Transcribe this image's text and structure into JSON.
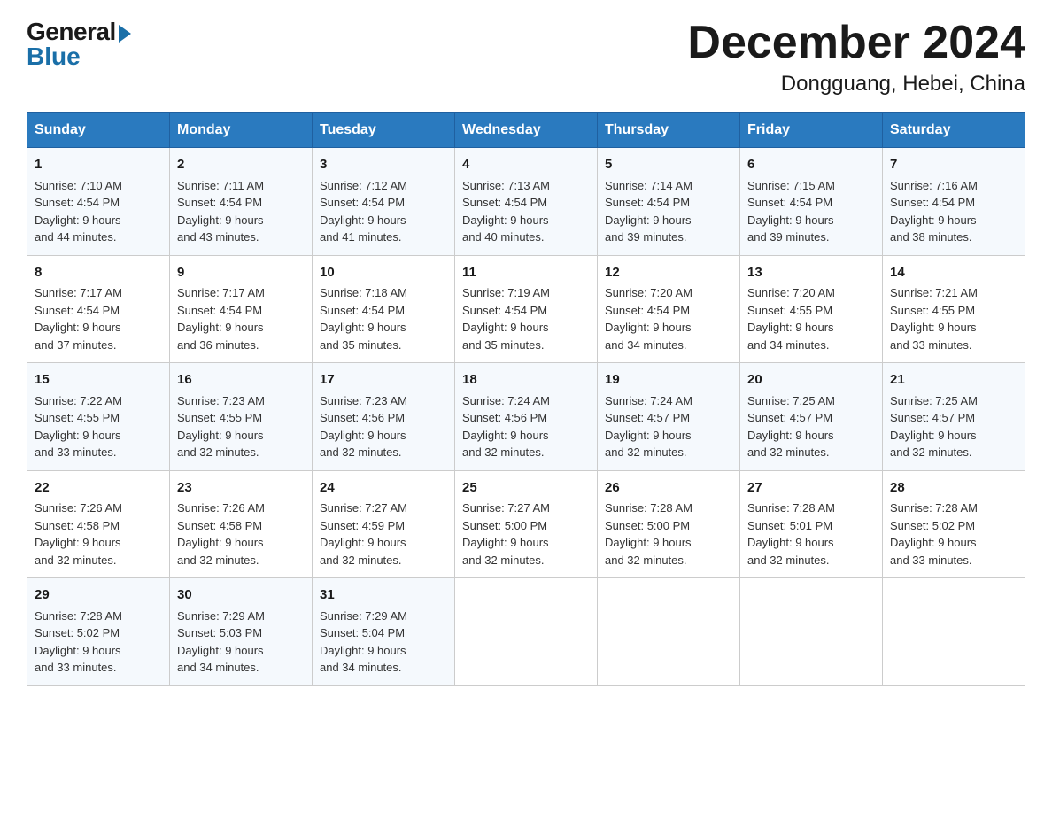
{
  "header": {
    "logo_general": "General",
    "logo_blue": "Blue",
    "month_title": "December 2024",
    "location": "Dongguang, Hebei, China"
  },
  "weekdays": [
    "Sunday",
    "Monday",
    "Tuesday",
    "Wednesday",
    "Thursday",
    "Friday",
    "Saturday"
  ],
  "weeks": [
    [
      {
        "day": "1",
        "sunrise": "7:10 AM",
        "sunset": "4:54 PM",
        "daylight": "9 hours and 44 minutes."
      },
      {
        "day": "2",
        "sunrise": "7:11 AM",
        "sunset": "4:54 PM",
        "daylight": "9 hours and 43 minutes."
      },
      {
        "day": "3",
        "sunrise": "7:12 AM",
        "sunset": "4:54 PM",
        "daylight": "9 hours and 41 minutes."
      },
      {
        "day": "4",
        "sunrise": "7:13 AM",
        "sunset": "4:54 PM",
        "daylight": "9 hours and 40 minutes."
      },
      {
        "day": "5",
        "sunrise": "7:14 AM",
        "sunset": "4:54 PM",
        "daylight": "9 hours and 39 minutes."
      },
      {
        "day": "6",
        "sunrise": "7:15 AM",
        "sunset": "4:54 PM",
        "daylight": "9 hours and 39 minutes."
      },
      {
        "day": "7",
        "sunrise": "7:16 AM",
        "sunset": "4:54 PM",
        "daylight": "9 hours and 38 minutes."
      }
    ],
    [
      {
        "day": "8",
        "sunrise": "7:17 AM",
        "sunset": "4:54 PM",
        "daylight": "9 hours and 37 minutes."
      },
      {
        "day": "9",
        "sunrise": "7:17 AM",
        "sunset": "4:54 PM",
        "daylight": "9 hours and 36 minutes."
      },
      {
        "day": "10",
        "sunrise": "7:18 AM",
        "sunset": "4:54 PM",
        "daylight": "9 hours and 35 minutes."
      },
      {
        "day": "11",
        "sunrise": "7:19 AM",
        "sunset": "4:54 PM",
        "daylight": "9 hours and 35 minutes."
      },
      {
        "day": "12",
        "sunrise": "7:20 AM",
        "sunset": "4:54 PM",
        "daylight": "9 hours and 34 minutes."
      },
      {
        "day": "13",
        "sunrise": "7:20 AM",
        "sunset": "4:55 PM",
        "daylight": "9 hours and 34 minutes."
      },
      {
        "day": "14",
        "sunrise": "7:21 AM",
        "sunset": "4:55 PM",
        "daylight": "9 hours and 33 minutes."
      }
    ],
    [
      {
        "day": "15",
        "sunrise": "7:22 AM",
        "sunset": "4:55 PM",
        "daylight": "9 hours and 33 minutes."
      },
      {
        "day": "16",
        "sunrise": "7:23 AM",
        "sunset": "4:55 PM",
        "daylight": "9 hours and 32 minutes."
      },
      {
        "day": "17",
        "sunrise": "7:23 AM",
        "sunset": "4:56 PM",
        "daylight": "9 hours and 32 minutes."
      },
      {
        "day": "18",
        "sunrise": "7:24 AM",
        "sunset": "4:56 PM",
        "daylight": "9 hours and 32 minutes."
      },
      {
        "day": "19",
        "sunrise": "7:24 AM",
        "sunset": "4:57 PM",
        "daylight": "9 hours and 32 minutes."
      },
      {
        "day": "20",
        "sunrise": "7:25 AM",
        "sunset": "4:57 PM",
        "daylight": "9 hours and 32 minutes."
      },
      {
        "day": "21",
        "sunrise": "7:25 AM",
        "sunset": "4:57 PM",
        "daylight": "9 hours and 32 minutes."
      }
    ],
    [
      {
        "day": "22",
        "sunrise": "7:26 AM",
        "sunset": "4:58 PM",
        "daylight": "9 hours and 32 minutes."
      },
      {
        "day": "23",
        "sunrise": "7:26 AM",
        "sunset": "4:58 PM",
        "daylight": "9 hours and 32 minutes."
      },
      {
        "day": "24",
        "sunrise": "7:27 AM",
        "sunset": "4:59 PM",
        "daylight": "9 hours and 32 minutes."
      },
      {
        "day": "25",
        "sunrise": "7:27 AM",
        "sunset": "5:00 PM",
        "daylight": "9 hours and 32 minutes."
      },
      {
        "day": "26",
        "sunrise": "7:28 AM",
        "sunset": "5:00 PM",
        "daylight": "9 hours and 32 minutes."
      },
      {
        "day": "27",
        "sunrise": "7:28 AM",
        "sunset": "5:01 PM",
        "daylight": "9 hours and 32 minutes."
      },
      {
        "day": "28",
        "sunrise": "7:28 AM",
        "sunset": "5:02 PM",
        "daylight": "9 hours and 33 minutes."
      }
    ],
    [
      {
        "day": "29",
        "sunrise": "7:28 AM",
        "sunset": "5:02 PM",
        "daylight": "9 hours and 33 minutes."
      },
      {
        "day": "30",
        "sunrise": "7:29 AM",
        "sunset": "5:03 PM",
        "daylight": "9 hours and 34 minutes."
      },
      {
        "day": "31",
        "sunrise": "7:29 AM",
        "sunset": "5:04 PM",
        "daylight": "9 hours and 34 minutes."
      },
      null,
      null,
      null,
      null
    ]
  ],
  "labels": {
    "sunrise": "Sunrise:",
    "sunset": "Sunset:",
    "daylight": "Daylight:"
  }
}
